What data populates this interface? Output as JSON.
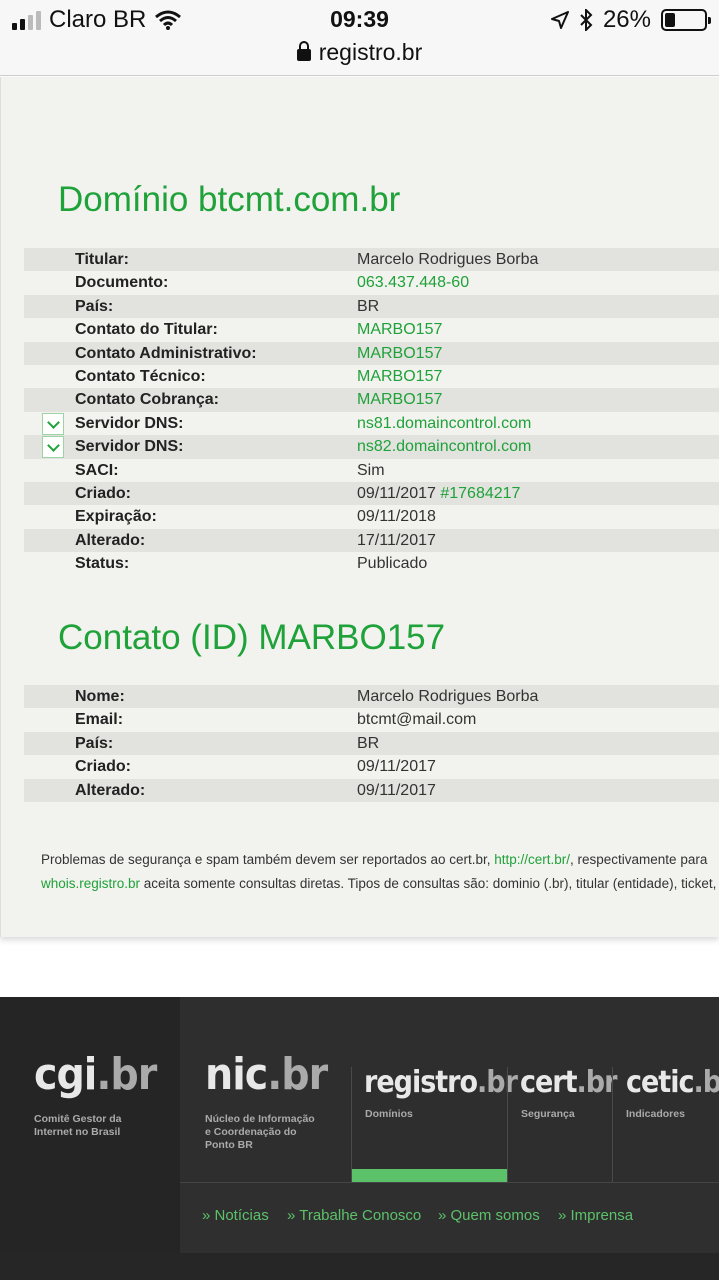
{
  "status_bar": {
    "carrier": "Claro BR",
    "time": "09:39",
    "battery": "26%",
    "battery_level": 0.26
  },
  "browser": {
    "url": "registro.br"
  },
  "domain_section": {
    "title": "Domínio btcmt.com.br",
    "rows": [
      {
        "label": "Titular:",
        "value": "Marcelo Rodrigues Borba"
      },
      {
        "label": "Documento:",
        "value": "063.437.448-60"
      },
      {
        "label": "País:",
        "value": "BR"
      },
      {
        "label": "Contato do Titular:",
        "value": "MARBO157"
      },
      {
        "label": "Contato Administrativo:",
        "value": "MARBO157"
      },
      {
        "label": "Contato Técnico:",
        "value": "MARBO157"
      },
      {
        "label": "Contato Cobrança:",
        "value": "MARBO157"
      },
      {
        "label": "Servidor DNS:",
        "value": "ns81.domaincontrol.com"
      },
      {
        "label": "Servidor DNS:",
        "value": "ns82.domaincontrol.com"
      },
      {
        "label": "SACI:",
        "value": "Sim"
      },
      {
        "label": "Criado:",
        "value": "09/11/2017",
        "extra": "#17684217"
      },
      {
        "label": "Expiração:",
        "value": "09/11/2018"
      },
      {
        "label": "Alterado:",
        "value": "17/11/2017"
      },
      {
        "label": "Status:",
        "value": "Publicado"
      }
    ]
  },
  "contact_section": {
    "title": "Contato (ID) MARBO157",
    "rows": [
      {
        "label": "Nome:",
        "value": "Marcelo Rodrigues Borba"
      },
      {
        "label": "Email:",
        "value": "btcmt@mail.com"
      },
      {
        "label": "País:",
        "value": "BR"
      },
      {
        "label": "Criado:",
        "value": "09/11/2017"
      },
      {
        "label": "Alterado:",
        "value": "09/11/2017"
      }
    ]
  },
  "notes": {
    "line1_text": "Problemas de segurança e spam também devem ser reportados ao cert.br, ",
    "line1_link": "http://cert.br/",
    "line1_rest": ", respectivamente para",
    "line2_link": "whois.registro.br",
    "line2_rest": " aceita somente consultas diretas. Tipos de consultas são: dominio (.br), titular (entidade), ticket,"
  },
  "footer": {
    "cgi": {
      "name": "cgi",
      "suffix": ".br",
      "sub": "Comitê Gestor da Internet no Brasil"
    },
    "nic": {
      "name": "nic",
      "suffix": ".br",
      "sub": "Núcleo de Informação e Coordenação do Ponto BR"
    },
    "registro": {
      "name": "registro",
      "suffix": ".br",
      "sub": "Domínios"
    },
    "cert": {
      "name": "cert",
      "suffix": ".br",
      "sub": "Segurança"
    },
    "cetic": {
      "name": "cetic",
      "suffix": ".br",
      "sub": "Indicadores"
    },
    "links": [
      "» Notícias",
      "» Trabalhe Conosco",
      "» Quem somos",
      "» Imprensa"
    ]
  },
  "colors": {
    "accent": "#1fa239",
    "footer_accent": "#5cc26a"
  }
}
